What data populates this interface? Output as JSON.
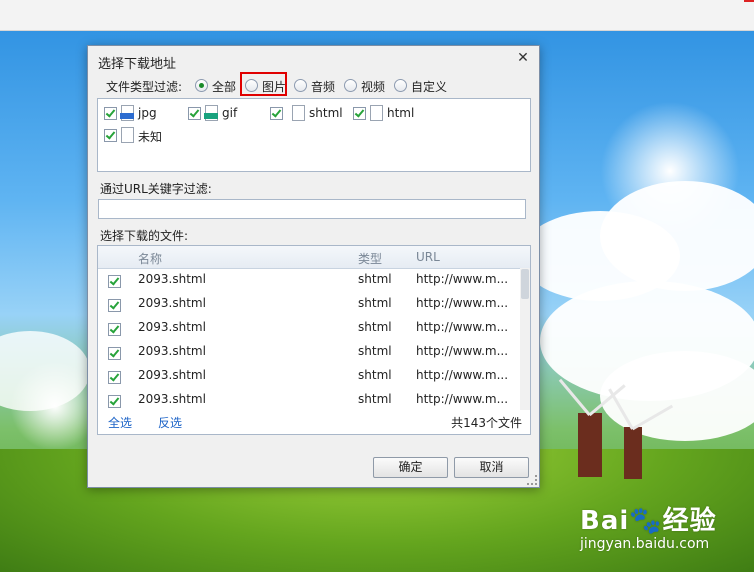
{
  "dialog": {
    "title": "选择下载地址",
    "close_symbol": "✕",
    "filter_label": "文件类型过滤:",
    "radio_options": [
      {
        "label": "全部",
        "checked": true
      },
      {
        "label": "图片",
        "checked": false
      },
      {
        "label": "音频",
        "checked": false
      },
      {
        "label": "视频",
        "checked": false
      },
      {
        "label": "自定义",
        "checked": false
      }
    ],
    "file_types": [
      {
        "label": "jpg",
        "checked": true,
        "icon": "jpg-file-icon"
      },
      {
        "label": "gif",
        "checked": true,
        "icon": "gif-file-icon"
      },
      {
        "label": "shtml",
        "checked": true,
        "icon": "document-icon"
      },
      {
        "label": "html",
        "checked": true,
        "icon": "document-icon"
      },
      {
        "label": "未知",
        "checked": true,
        "icon": "document-icon"
      }
    ],
    "url_filter_label": "通过URL关键字过滤:",
    "url_filter_value": "",
    "files_label": "选择下载的文件:",
    "table": {
      "headers": {
        "name": "名称",
        "type": "类型",
        "url": "URL"
      },
      "rows": [
        {
          "checked": true,
          "name": "2093.shtml",
          "type": "shtml",
          "url": "http://www.m..."
        },
        {
          "checked": true,
          "name": "2093.shtml",
          "type": "shtml",
          "url": "http://www.m..."
        },
        {
          "checked": true,
          "name": "2093.shtml",
          "type": "shtml",
          "url": "http://www.m..."
        },
        {
          "checked": true,
          "name": "2093.shtml",
          "type": "shtml",
          "url": "http://www.m..."
        },
        {
          "checked": true,
          "name": "2093.shtml",
          "type": "shtml",
          "url": "http://www.m..."
        },
        {
          "checked": true,
          "name": "2093.shtml",
          "type": "shtml",
          "url": "http://www.m..."
        }
      ]
    },
    "select_all": "全选",
    "invert_selection": "反选",
    "file_count": "共143个文件",
    "ok_button": "确定",
    "cancel_button": "取消"
  },
  "watermark": {
    "logo": "Bai🐾经验",
    "url": "jingyan.baidu.com"
  },
  "colors": {
    "accent_link": "#1c63c7",
    "highlight": "#e00000",
    "check_green": "#27a33a"
  }
}
